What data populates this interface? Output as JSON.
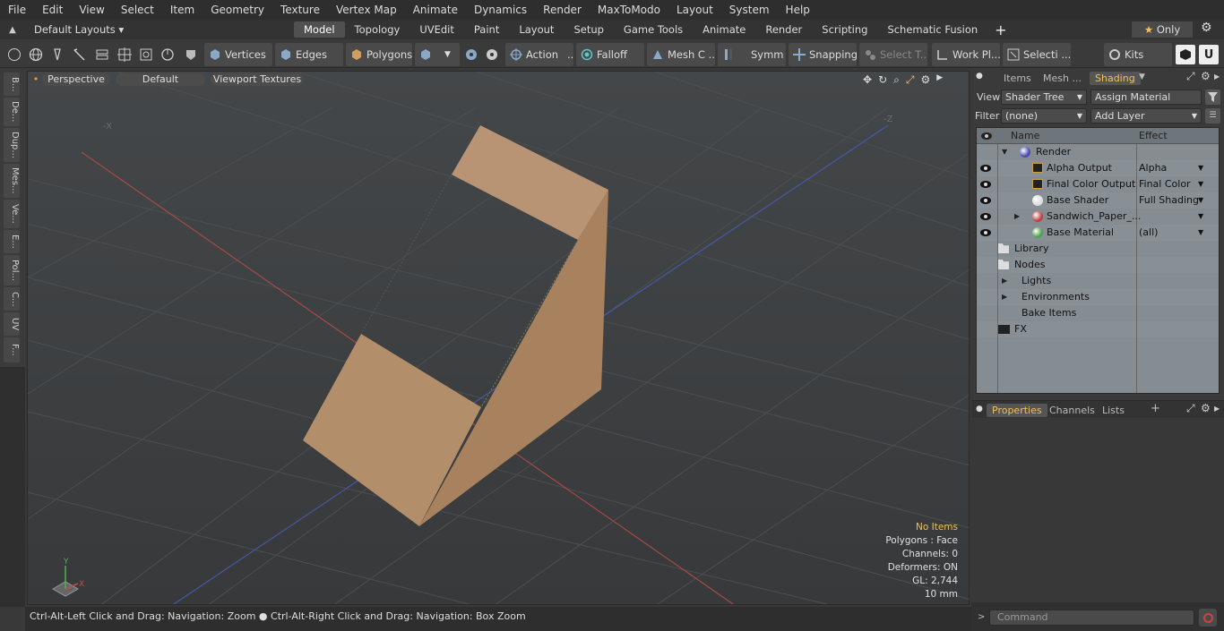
{
  "menu": [
    "File",
    "Edit",
    "View",
    "Select",
    "Item",
    "Geometry",
    "Texture",
    "Vertex Map",
    "Animate",
    "Dynamics",
    "Render",
    "MaxToModo",
    "Layout",
    "System",
    "Help"
  ],
  "layout_selector": "Default Layouts",
  "tabs": [
    "Model",
    "Topology",
    "UVEdit",
    "Paint",
    "Layout",
    "Setup",
    "Game Tools",
    "Animate",
    "Render",
    "Scripting",
    "Schematic Fusion"
  ],
  "active_tab": "Model",
  "only_label": "Only",
  "toolbar": {
    "vertices": "Vertices",
    "edges": "Edges",
    "polygons": "Polygons",
    "action": "Action",
    "action_more": "...",
    "falloff": "Falloff",
    "mesh": "Mesh C ...",
    "symm": "Symm ...",
    "snapping": "Snapping",
    "select_t": "Select T...",
    "work_pl": "Work Pl...",
    "selecti": "Selecti ...",
    "kits": "Kits"
  },
  "left_tabs": [
    "B...",
    "De...",
    "Dup...",
    "Mes...",
    "Ve...",
    "E...",
    "Pol...",
    "C...",
    "UV",
    "F..."
  ],
  "viewport": {
    "perspective": "Perspective",
    "default": "Default",
    "textures": "Viewport Textures",
    "axis_x": "-X",
    "axis_z": "-Z",
    "info": {
      "no_items": "No Items",
      "polygons": "Polygons : Face",
      "channels": "Channels: 0",
      "deformers": "Deformers: ON",
      "gl": "GL: 2,744",
      "units": "10 mm"
    },
    "gizmo": {
      "y": "Y",
      "x": "X"
    }
  },
  "status": {
    "left": "Ctrl-Alt-Left Click and Drag: Navigation: Zoom",
    "right": "Ctrl-Alt-Right Click and Drag: Navigation: Box Zoom"
  },
  "right_tabs": [
    "Items",
    "Mesh ...",
    "Shading"
  ],
  "active_right_tab": "Shading",
  "view_label": "View",
  "view_value": "Shader Tree",
  "assign_material": "Assign Material",
  "filter_label": "Filter",
  "filter_value": "(none)",
  "add_layer": "Add Layer",
  "tree_headers": {
    "name": "Name",
    "effect": "Effect"
  },
  "tree": [
    {
      "name": "Render",
      "effect": "",
      "ball": "#4a4ab0",
      "indent": 0,
      "eye": false
    },
    {
      "name": "Alpha Output",
      "effect": "Alpha",
      "ball": "",
      "indent": 1,
      "eye": true
    },
    {
      "name": "Final Color Output",
      "effect": "Final Color",
      "ball": "",
      "indent": 1,
      "eye": true
    },
    {
      "name": "Base Shader",
      "effect": "Full Shading",
      "ball": "#dddddd",
      "indent": 1,
      "eye": true
    },
    {
      "name": "Sandwich_Paper_...",
      "effect": "",
      "ball": "#c04040",
      "indent": 1,
      "eye": true
    },
    {
      "name": "Base Material",
      "effect": "(all)",
      "ball": "#50a050",
      "indent": 1,
      "eye": true
    },
    {
      "name": "Library",
      "effect": "",
      "ball": "",
      "indent": 0,
      "eye": false
    },
    {
      "name": "Nodes",
      "effect": "",
      "ball": "",
      "indent": 0,
      "eye": false
    },
    {
      "name": "Lights",
      "effect": "",
      "ball": "",
      "indent": 0,
      "eye": false
    },
    {
      "name": "Environments",
      "effect": "",
      "ball": "",
      "indent": 0,
      "eye": false
    },
    {
      "name": "Bake Items",
      "effect": "",
      "ball": "",
      "indent": 0,
      "eye": false
    },
    {
      "name": "FX",
      "effect": "",
      "ball": "",
      "indent": 0,
      "eye": false
    }
  ],
  "bottom_tabs": [
    "Properties",
    "Channels",
    "Lists"
  ],
  "command_placeholder": "Command",
  "colors": {
    "accent": "#f0c060",
    "model_color": "#b38e6b"
  }
}
